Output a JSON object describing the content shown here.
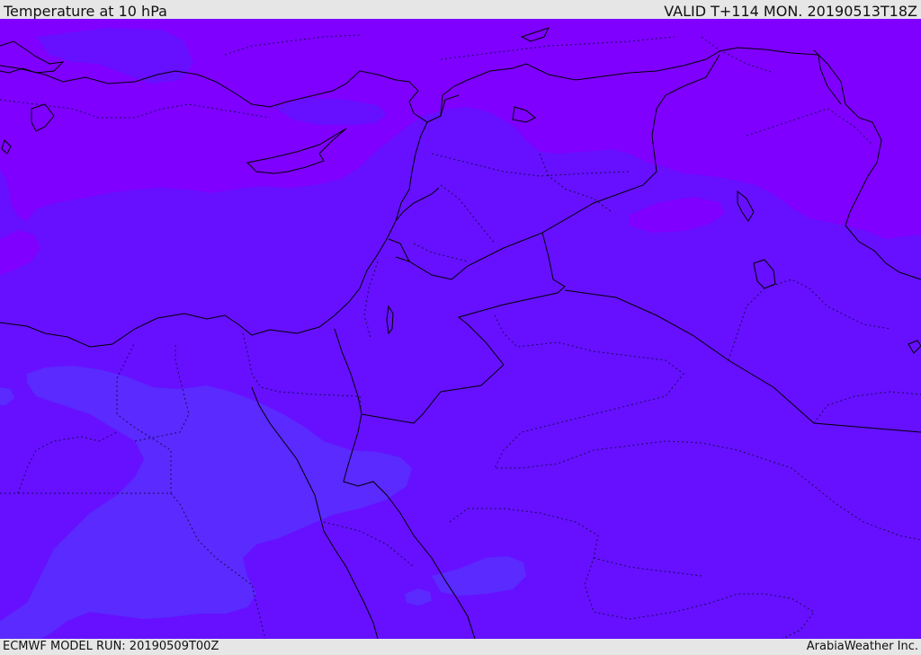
{
  "header": {
    "title": "Temperature at 10 hPa",
    "valid": "VALID T+114 MON. 20190513T18Z"
  },
  "footer": {
    "model_run": "ECMWF MODEL RUN: 20190509T00Z",
    "brand": "ArabiaWeather Inc."
  },
  "map": {
    "variable": "temperature",
    "level": "10 hPa",
    "region": "Middle East",
    "colors": {
      "violet_warm": "#7f00ff",
      "indigo_mid": "#6610ff",
      "blue_cool": "#5a2aff",
      "coastline": "#000000",
      "borders": "#1a0a55"
    }
  }
}
